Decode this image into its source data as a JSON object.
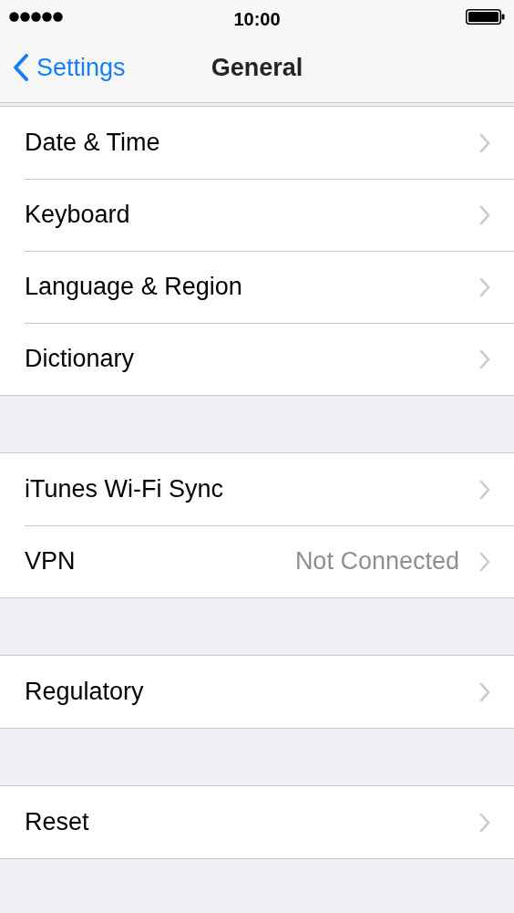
{
  "status_bar": {
    "time": "10:00"
  },
  "nav": {
    "back_label": "Settings",
    "title": "General"
  },
  "groups": [
    {
      "rows": [
        {
          "label": "Date & Time"
        },
        {
          "label": "Keyboard"
        },
        {
          "label": "Language & Region"
        },
        {
          "label": "Dictionary"
        }
      ]
    },
    {
      "rows": [
        {
          "label": "iTunes Wi-Fi Sync"
        },
        {
          "label": "VPN",
          "detail": "Not Connected"
        }
      ]
    },
    {
      "rows": [
        {
          "label": "Regulatory"
        }
      ]
    },
    {
      "rows": [
        {
          "label": "Reset"
        }
      ]
    }
  ]
}
